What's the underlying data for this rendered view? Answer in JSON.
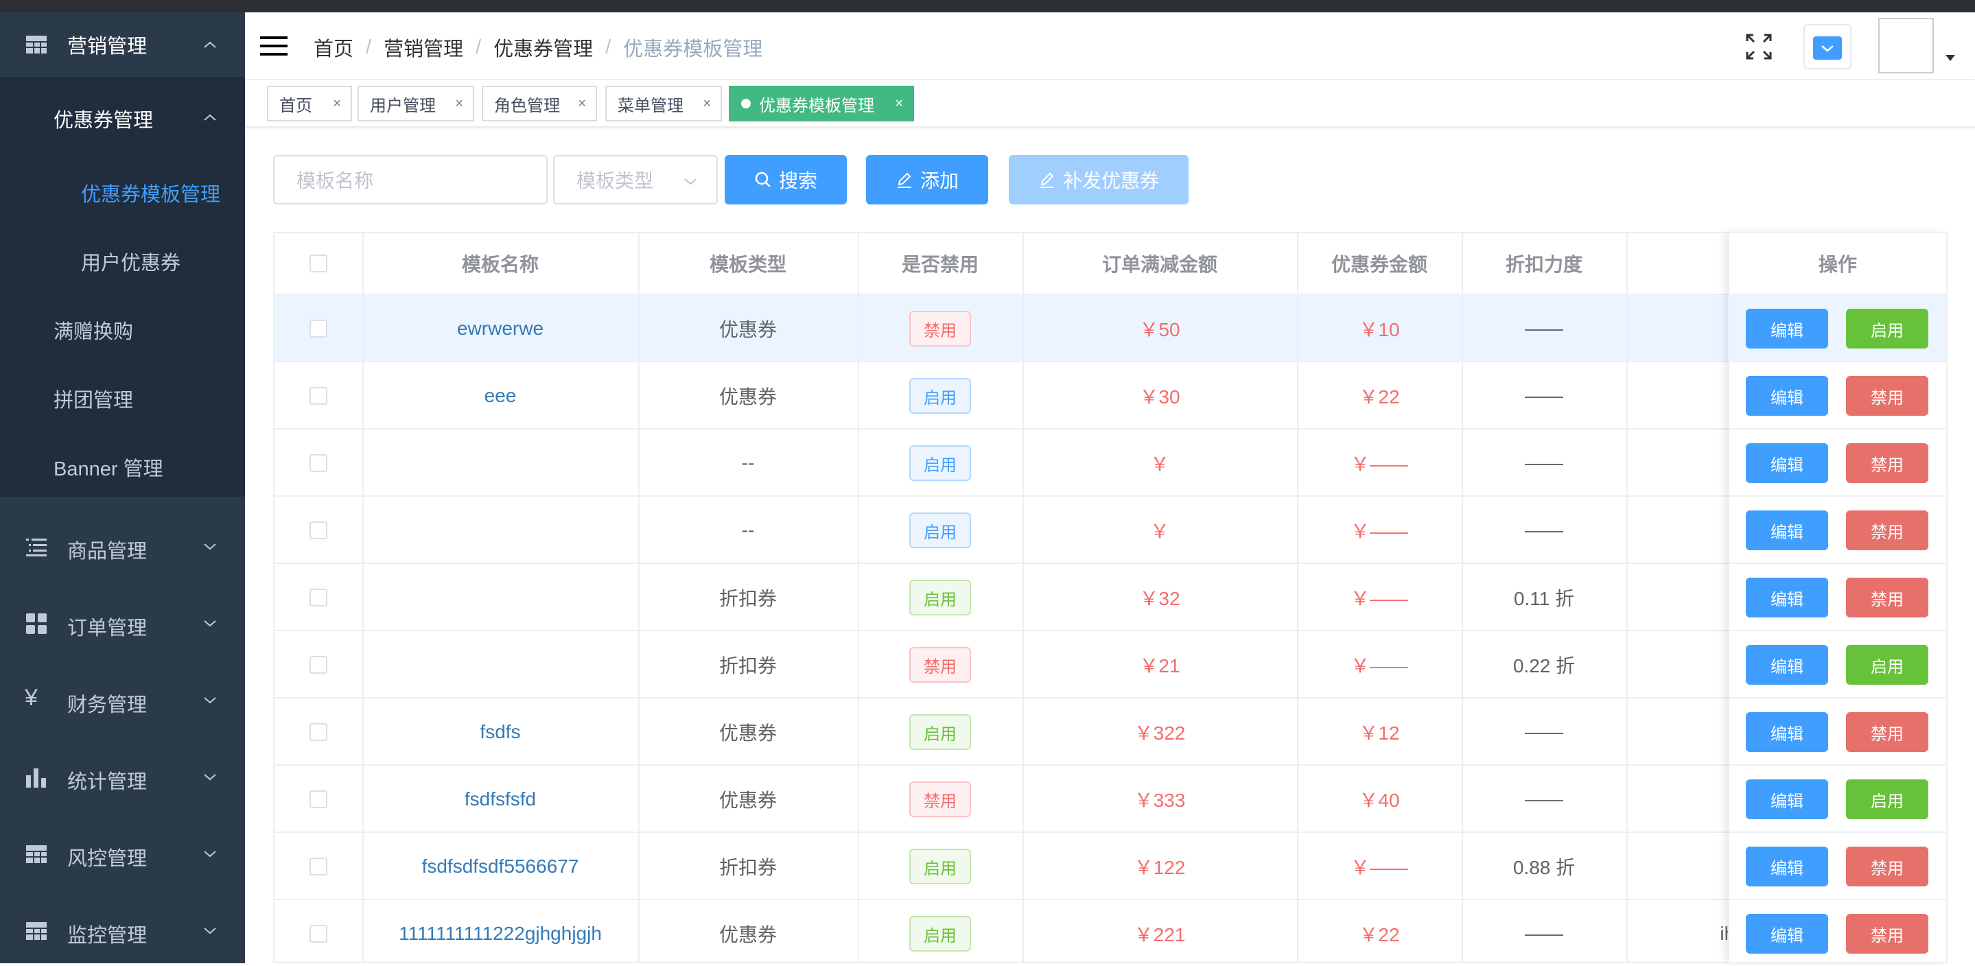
{
  "sidebar": {
    "groups": [
      {
        "label": "营销管理",
        "icon": "grid-icon",
        "expanded": true
      },
      {
        "label": "商品管理",
        "icon": "list-icon"
      },
      {
        "label": "订单管理",
        "icon": "apps-icon"
      },
      {
        "label": "财务管理",
        "icon": "yen-icon"
      },
      {
        "label": "统计管理",
        "icon": "bar-chart-icon"
      },
      {
        "label": "风控管理",
        "icon": "table-icon"
      },
      {
        "label": "监控管理",
        "icon": "table-icon"
      }
    ],
    "sub": {
      "coupon_group": "优惠券管理",
      "coupon_template": "优惠券模板管理",
      "user_coupon": "用户优惠券",
      "gift": "满赠换购",
      "group_buy": "拼团管理",
      "banner": "Banner 管理"
    }
  },
  "breadcrumb": [
    "首页",
    "营销管理",
    "优惠券管理",
    "优惠券模板管理"
  ],
  "tags": [
    "首页",
    "用户管理",
    "角色管理",
    "菜单管理",
    "优惠券模板管理"
  ],
  "filters": {
    "name_placeholder": "模板名称",
    "type_placeholder": "模板类型",
    "search_label": "搜索",
    "add_label": "添加",
    "reissue_label": "补发优惠券"
  },
  "table": {
    "columns": [
      "模板名称",
      "模板类型",
      "是否禁用",
      "订单满减金额",
      "优惠券金额",
      "折扣力度",
      "操作"
    ],
    "edit_label": "编辑",
    "rows": [
      {
        "name": "ewrwerwe",
        "type": "优惠券",
        "status": "禁用",
        "order": "￥50",
        "coupon": "￥10",
        "discount": "——",
        "extra": "",
        "action": "启用"
      },
      {
        "name": "eee",
        "type": "优惠券",
        "status": "启用",
        "order": "￥30",
        "coupon": "￥22",
        "discount": "——",
        "extra": "",
        "action": "禁用"
      },
      {
        "name": "",
        "type": "--",
        "status": "启用",
        "order": "￥",
        "coupon": "￥——",
        "discount": "——",
        "extra": "",
        "action": "禁用"
      },
      {
        "name": "",
        "type": "--",
        "status": "启用",
        "order": "￥",
        "coupon": "￥——",
        "discount": "——",
        "extra": "",
        "action": "禁用"
      },
      {
        "name": "",
        "type": "折扣券",
        "status": "启用",
        "order": "￥32",
        "coupon": "￥——",
        "discount": "0.11 折",
        "extra": "",
        "action": "禁用"
      },
      {
        "name": "",
        "type": "折扣券",
        "status": "禁用",
        "order": "￥21",
        "coupon": "￥——",
        "discount": "0.22 折",
        "extra": "",
        "action": "启用"
      },
      {
        "name": "fsdfs",
        "type": "优惠券",
        "status": "启用",
        "order": "￥322",
        "coupon": "￥12",
        "discount": "——",
        "extra": "",
        "action": "禁用"
      },
      {
        "name": "fsdfsfsfd",
        "type": "优惠券",
        "status": "禁用",
        "order": "￥333",
        "coupon": "￥40",
        "discount": "——",
        "extra": "",
        "action": "启用"
      },
      {
        "name": "fsdfsdfsdf5566677",
        "type": "折扣券",
        "status": "启用",
        "order": "￥122",
        "coupon": "￥——",
        "discount": "0.88 折",
        "extra": "",
        "action": "禁用"
      },
      {
        "name": "1111111111222gjhghjgjh",
        "type": "优惠券",
        "status": "启用",
        "order": "￥221",
        "coupon": "￥22",
        "discount": "——",
        "extra": "ihih",
        "action": "禁用"
      }
    ]
  },
  "colors": {
    "primary": "#409eff",
    "success": "#67c23a",
    "danger": "#e6716b",
    "tag_active": "#42b983",
    "sidebar": "#2b3a4b"
  }
}
